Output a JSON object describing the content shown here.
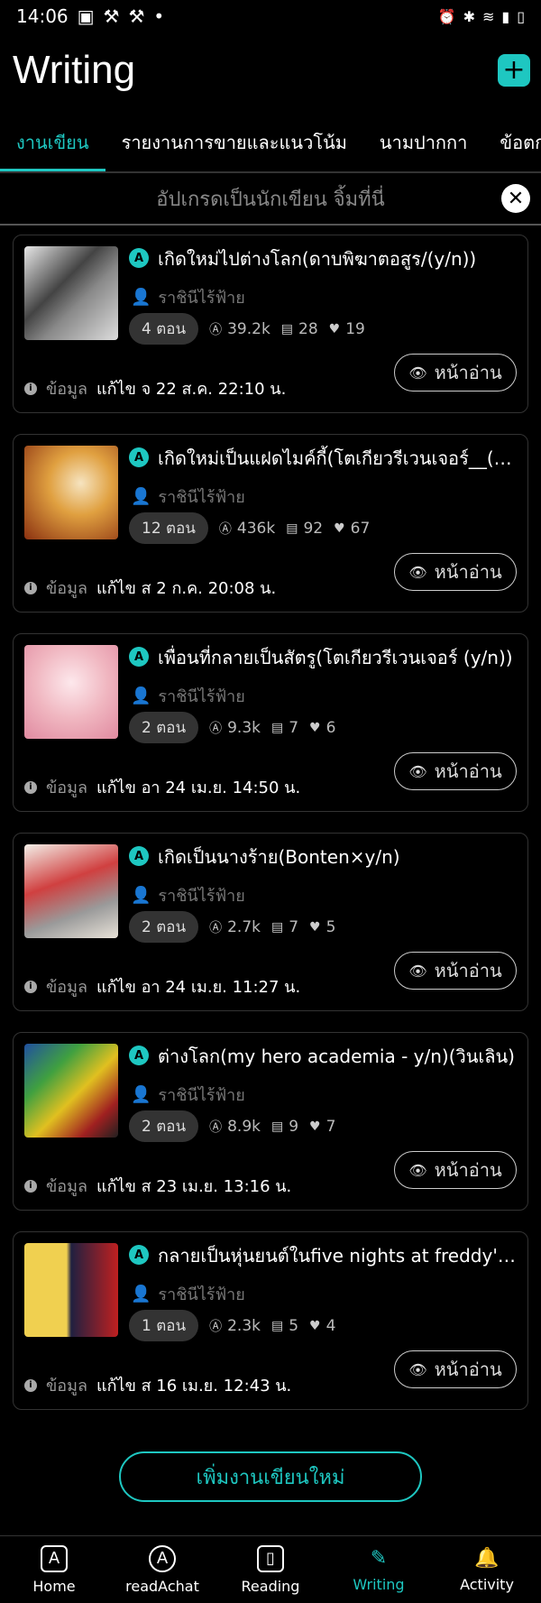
{
  "status": {
    "time": "14:06",
    "left_icons": [
      "image-icon",
      "tools-icon",
      "tools-icon",
      "dot-icon"
    ],
    "right_icons": [
      "alarm-icon",
      "bluetooth-icon",
      "wifi-icon",
      "signal-icon",
      "battery-icon"
    ]
  },
  "header": {
    "title": "Writing",
    "add_icon": "plus-icon"
  },
  "tabs": [
    {
      "label": "งานเขียน",
      "active": true
    },
    {
      "label": "รายงานการขายและแนวโน้ม",
      "active": false
    },
    {
      "label": "นามปากกา",
      "active": false
    },
    {
      "label": "ข้อตกลงแ",
      "active": false
    }
  ],
  "upgrade": {
    "text": "อัปเกรดเป็นนักเขียน จิ้มที่นี่"
  },
  "stories": [
    {
      "title": "เกิดใหม่ไปต่างโลก(ดาบพิฆาตอสูร/(y/n))",
      "author": "ราชินีไร้ฟ้าย",
      "chapters": "4 ตอน",
      "views": "39.2k",
      "comments": "28",
      "likes": "19",
      "info_label": "ข้อมูล",
      "edited": "แก้ไข จ 22 ส.ค. 22:10 น.",
      "read_label": "หน้าอ่าน"
    },
    {
      "title": "เกิดใหม่เป็นแฝดไมค์กี้(โตเกียวรีเวนเจอร์__(y/n))",
      "author": "ราชินีไร้ฟ้าย",
      "chapters": "12 ตอน",
      "views": "436k",
      "comments": "92",
      "likes": "67",
      "info_label": "ข้อมูล",
      "edited": "แก้ไข ส 2 ก.ค. 20:08 น.",
      "read_label": "หน้าอ่าน"
    },
    {
      "title": "เพื่อนที่กลายเป็นสัตรู(โตเกียวรีเวนเจอร์ (y/n))",
      "author": "ราชินีไร้ฟ้าย",
      "chapters": "2 ตอน",
      "views": "9.3k",
      "comments": "7",
      "likes": "6",
      "info_label": "ข้อมูล",
      "edited": "แก้ไข อา 24 เม.ย. 14:50 น.",
      "read_label": "หน้าอ่าน"
    },
    {
      "title": "เกิดเป็นนางร้าย(Bonten×y/n)",
      "author": "ราชินีไร้ฟ้าย",
      "chapters": "2 ตอน",
      "views": "2.7k",
      "comments": "7",
      "likes": "5",
      "info_label": "ข้อมูล",
      "edited": "แก้ไข อา 24 เม.ย. 11:27 น.",
      "read_label": "หน้าอ่าน"
    },
    {
      "title": "ต่างโลก(my hero academia - y/n)(วินเลิน)",
      "author": "ราชินีไร้ฟ้าย",
      "chapters": "2 ตอน",
      "views": "8.9k",
      "comments": "9",
      "likes": "7",
      "info_label": "ข้อมูล",
      "edited": "แก้ไข ส 23 เม.ย. 13:16 น.",
      "read_label": "หน้าอ่าน"
    },
    {
      "title": "กลายเป็นหุ่นยนต์ในfive nights at freddy's cit...",
      "author": "ราชินีไร้ฟ้าย",
      "chapters": "1 ตอน",
      "views": "2.3k",
      "comments": "5",
      "likes": "4",
      "info_label": "ข้อมูล",
      "edited": "แก้ไข ส 16 เม.ย. 12:43 น.",
      "read_label": "หน้าอ่าน"
    }
  ],
  "new_work_label": "เพิ่มงานเขียนใหม่",
  "nav": [
    {
      "label": "Home",
      "icon": "home-icon",
      "active": false
    },
    {
      "label": "readAchat",
      "icon": "chat-icon",
      "active": false
    },
    {
      "label": "Reading",
      "icon": "book-icon",
      "active": false
    },
    {
      "label": "Writing",
      "icon": "pen-icon",
      "active": true
    },
    {
      "label": "Activity",
      "icon": "bell-icon",
      "active": false
    }
  ],
  "colors": {
    "accent": "#1ec7c1",
    "background": "#000000"
  }
}
